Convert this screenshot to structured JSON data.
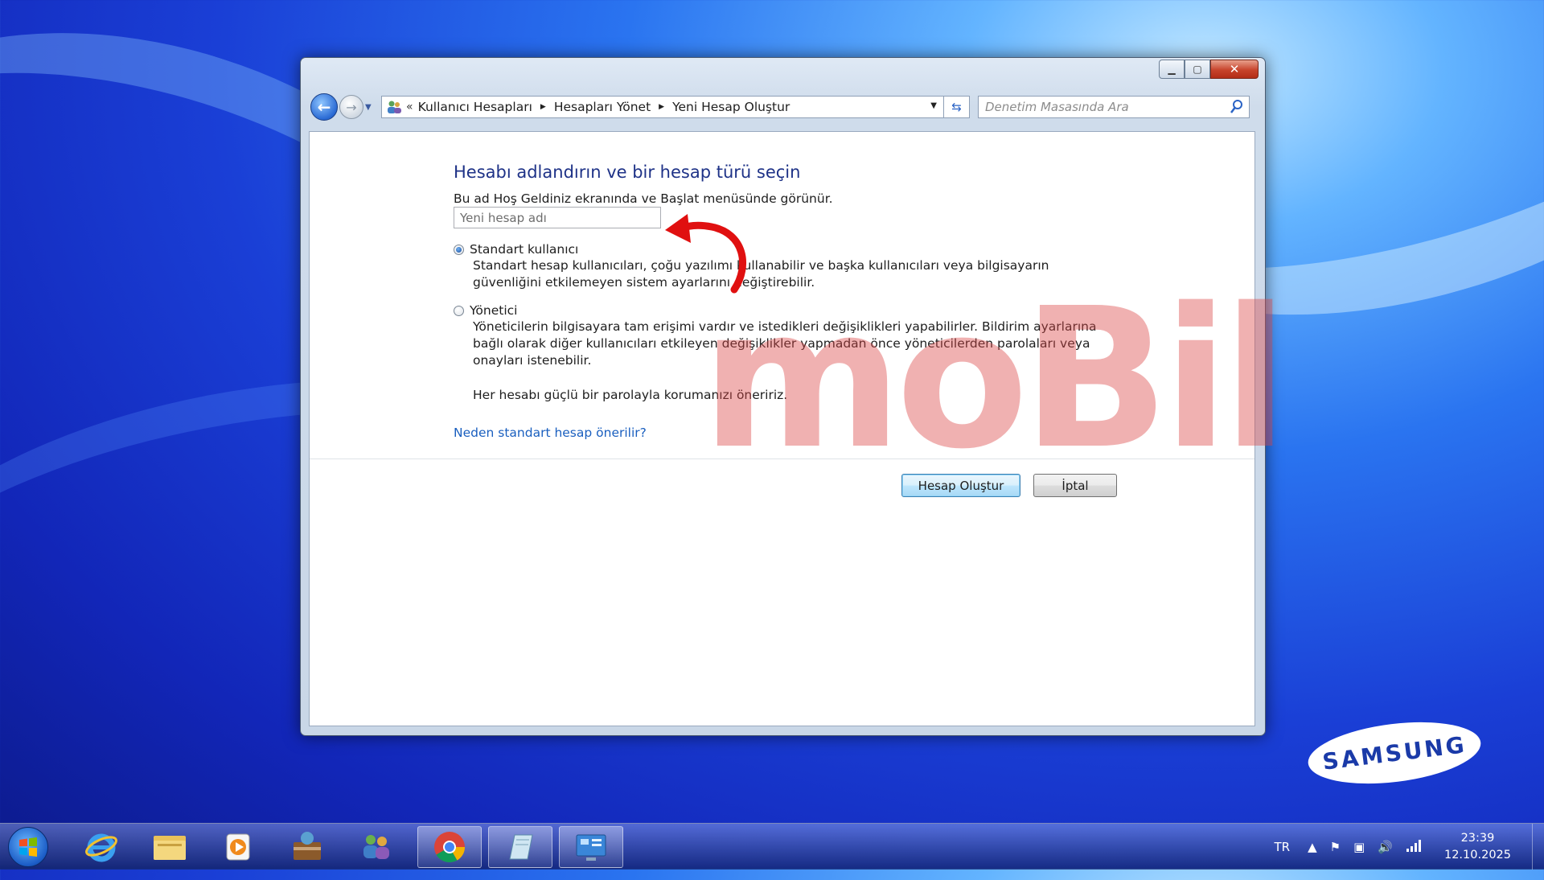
{
  "window": {
    "address": {
      "prefix": "«",
      "crumbs": [
        "Kullanıcı Hesapları",
        "Hesapları Yönet",
        "Yeni Hesap Oluştur"
      ]
    },
    "search": {
      "placeholder": "Denetim Masasında Ara"
    },
    "content": {
      "title": "Hesabı adlandırın ve bir hesap türü seçin",
      "subtitle": "Bu ad Hoş Geldiniz ekranında ve Başlat menüsünde görünür.",
      "name_input": {
        "placeholder": "Yeni hesap adı",
        "value": ""
      },
      "options": [
        {
          "label": "Standart kullanıcı",
          "selected": true,
          "description": "Standart hesap kullanıcıları, çoğu yazılımı kullanabilir ve başka kullanıcıları veya bilgisayarın güvenliğini etkilemeyen sistem ayarlarını değiştirebilir."
        },
        {
          "label": "Yönetici",
          "selected": false,
          "description": "Yöneticilerin bilgisayara tam erişimi vardır ve istedikleri değişiklikleri yapabilirler. Bildirim ayarlarına bağlı olarak diğer kullanıcıları etkileyen değişiklikler yapmadan önce yöneticilerden parolaları veya onayları istenebilir."
        }
      ],
      "recommendation": "Her hesabı güçlü bir parolayla korumanızı öneririz.",
      "link": "Neden standart hesap önerilir?",
      "buttons": {
        "create": "Hesap Oluştur",
        "cancel": "İptal"
      }
    }
  },
  "watermark": "moBil",
  "brand": "SAMSUNG",
  "taskbar": {
    "language": "TR",
    "clock": {
      "time": "23:39",
      "date": "12.10.2025"
    }
  },
  "colors": {
    "title_blue": "#1e3287",
    "link_blue": "#1a5fbf",
    "close_red": "#c7432b",
    "arrow_red": "#e01010"
  }
}
